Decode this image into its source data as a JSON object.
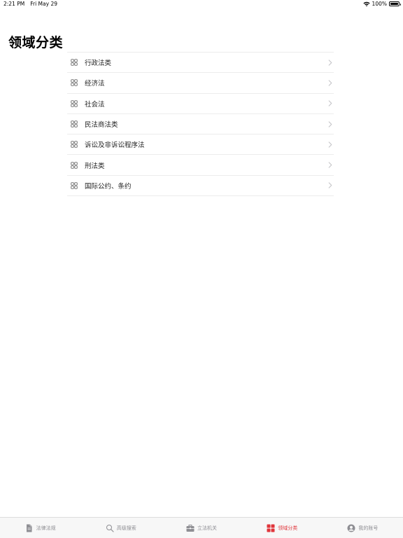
{
  "status_bar": {
    "time": "2:21 PM",
    "date": "Fri May 29",
    "battery": "100%",
    "battery_level": 1.0
  },
  "page": {
    "title": "领域分类"
  },
  "categories": [
    {
      "label": "行政法类"
    },
    {
      "label": "经济法"
    },
    {
      "label": "社会法"
    },
    {
      "label": "民法商法类"
    },
    {
      "label": "诉讼及非诉讼程序法"
    },
    {
      "label": "刑法类"
    },
    {
      "label": "国际公约、条约"
    }
  ],
  "tab_bar": {
    "active_color": "#e0353b",
    "inactive_color": "#8e8e93",
    "tabs": [
      {
        "label": "法律法规",
        "icon": "document-icon",
        "active": false
      },
      {
        "label": "高级搜索",
        "icon": "search-icon",
        "active": false
      },
      {
        "label": "立法机关",
        "icon": "briefcase-icon",
        "active": false
      },
      {
        "label": "领域分类",
        "icon": "grid-icon",
        "active": true
      },
      {
        "label": "我的账号",
        "icon": "user-icon",
        "active": false
      }
    ]
  }
}
